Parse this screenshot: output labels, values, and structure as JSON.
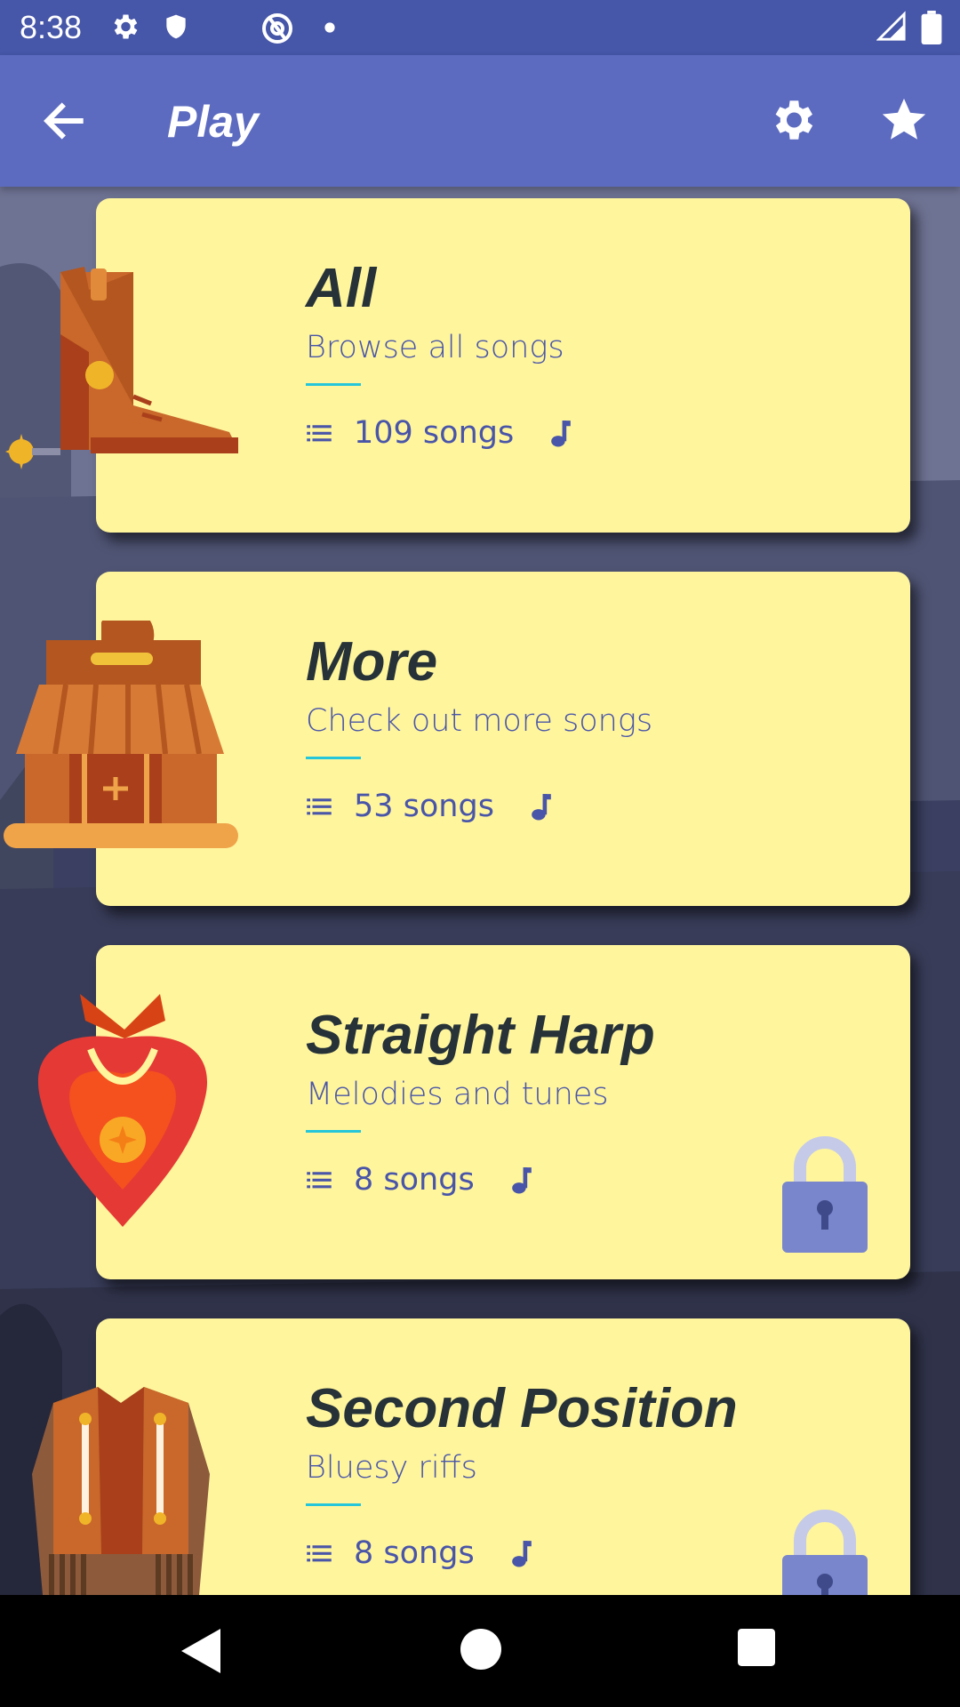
{
  "status_bar": {
    "time": "8:38"
  },
  "app_bar": {
    "title": "Play"
  },
  "cards": [
    {
      "title": "All",
      "subtitle": "Browse all songs",
      "count": "109 songs",
      "locked": false
    },
    {
      "title": "More",
      "subtitle": "Check out more songs",
      "count": "53 songs",
      "locked": false
    },
    {
      "title": "Straight Harp",
      "subtitle": "Melodies and tunes",
      "count": "8 songs",
      "locked": true
    },
    {
      "title": "Second Position",
      "subtitle": "Bluesy riffs",
      "count": "8 songs",
      "locked": true
    }
  ],
  "icons": {
    "status": [
      "gear-icon",
      "shield-icon",
      "at-sign-icon",
      "dot-icon",
      "signal-icon",
      "battery-icon"
    ],
    "app_bar": [
      "back-arrow-icon",
      "gear-icon",
      "star-icon"
    ],
    "card": [
      "list-icon",
      "music-note-icon",
      "lock-icon"
    ],
    "illustrations": [
      "cowboy-boot-illustration",
      "saloon-illustration",
      "bandana-illustration",
      "vest-illustration"
    ],
    "nav": [
      "back-triangle-icon",
      "home-circle-icon",
      "recents-square-icon"
    ]
  },
  "colors": {
    "status_bar": "#4656a8",
    "app_bar": "#5c6bc0",
    "card": "#fff59d",
    "title_text": "#263238",
    "accent_text": "#4955a8",
    "rule": "#26c6da",
    "lock": "#7986cb"
  }
}
